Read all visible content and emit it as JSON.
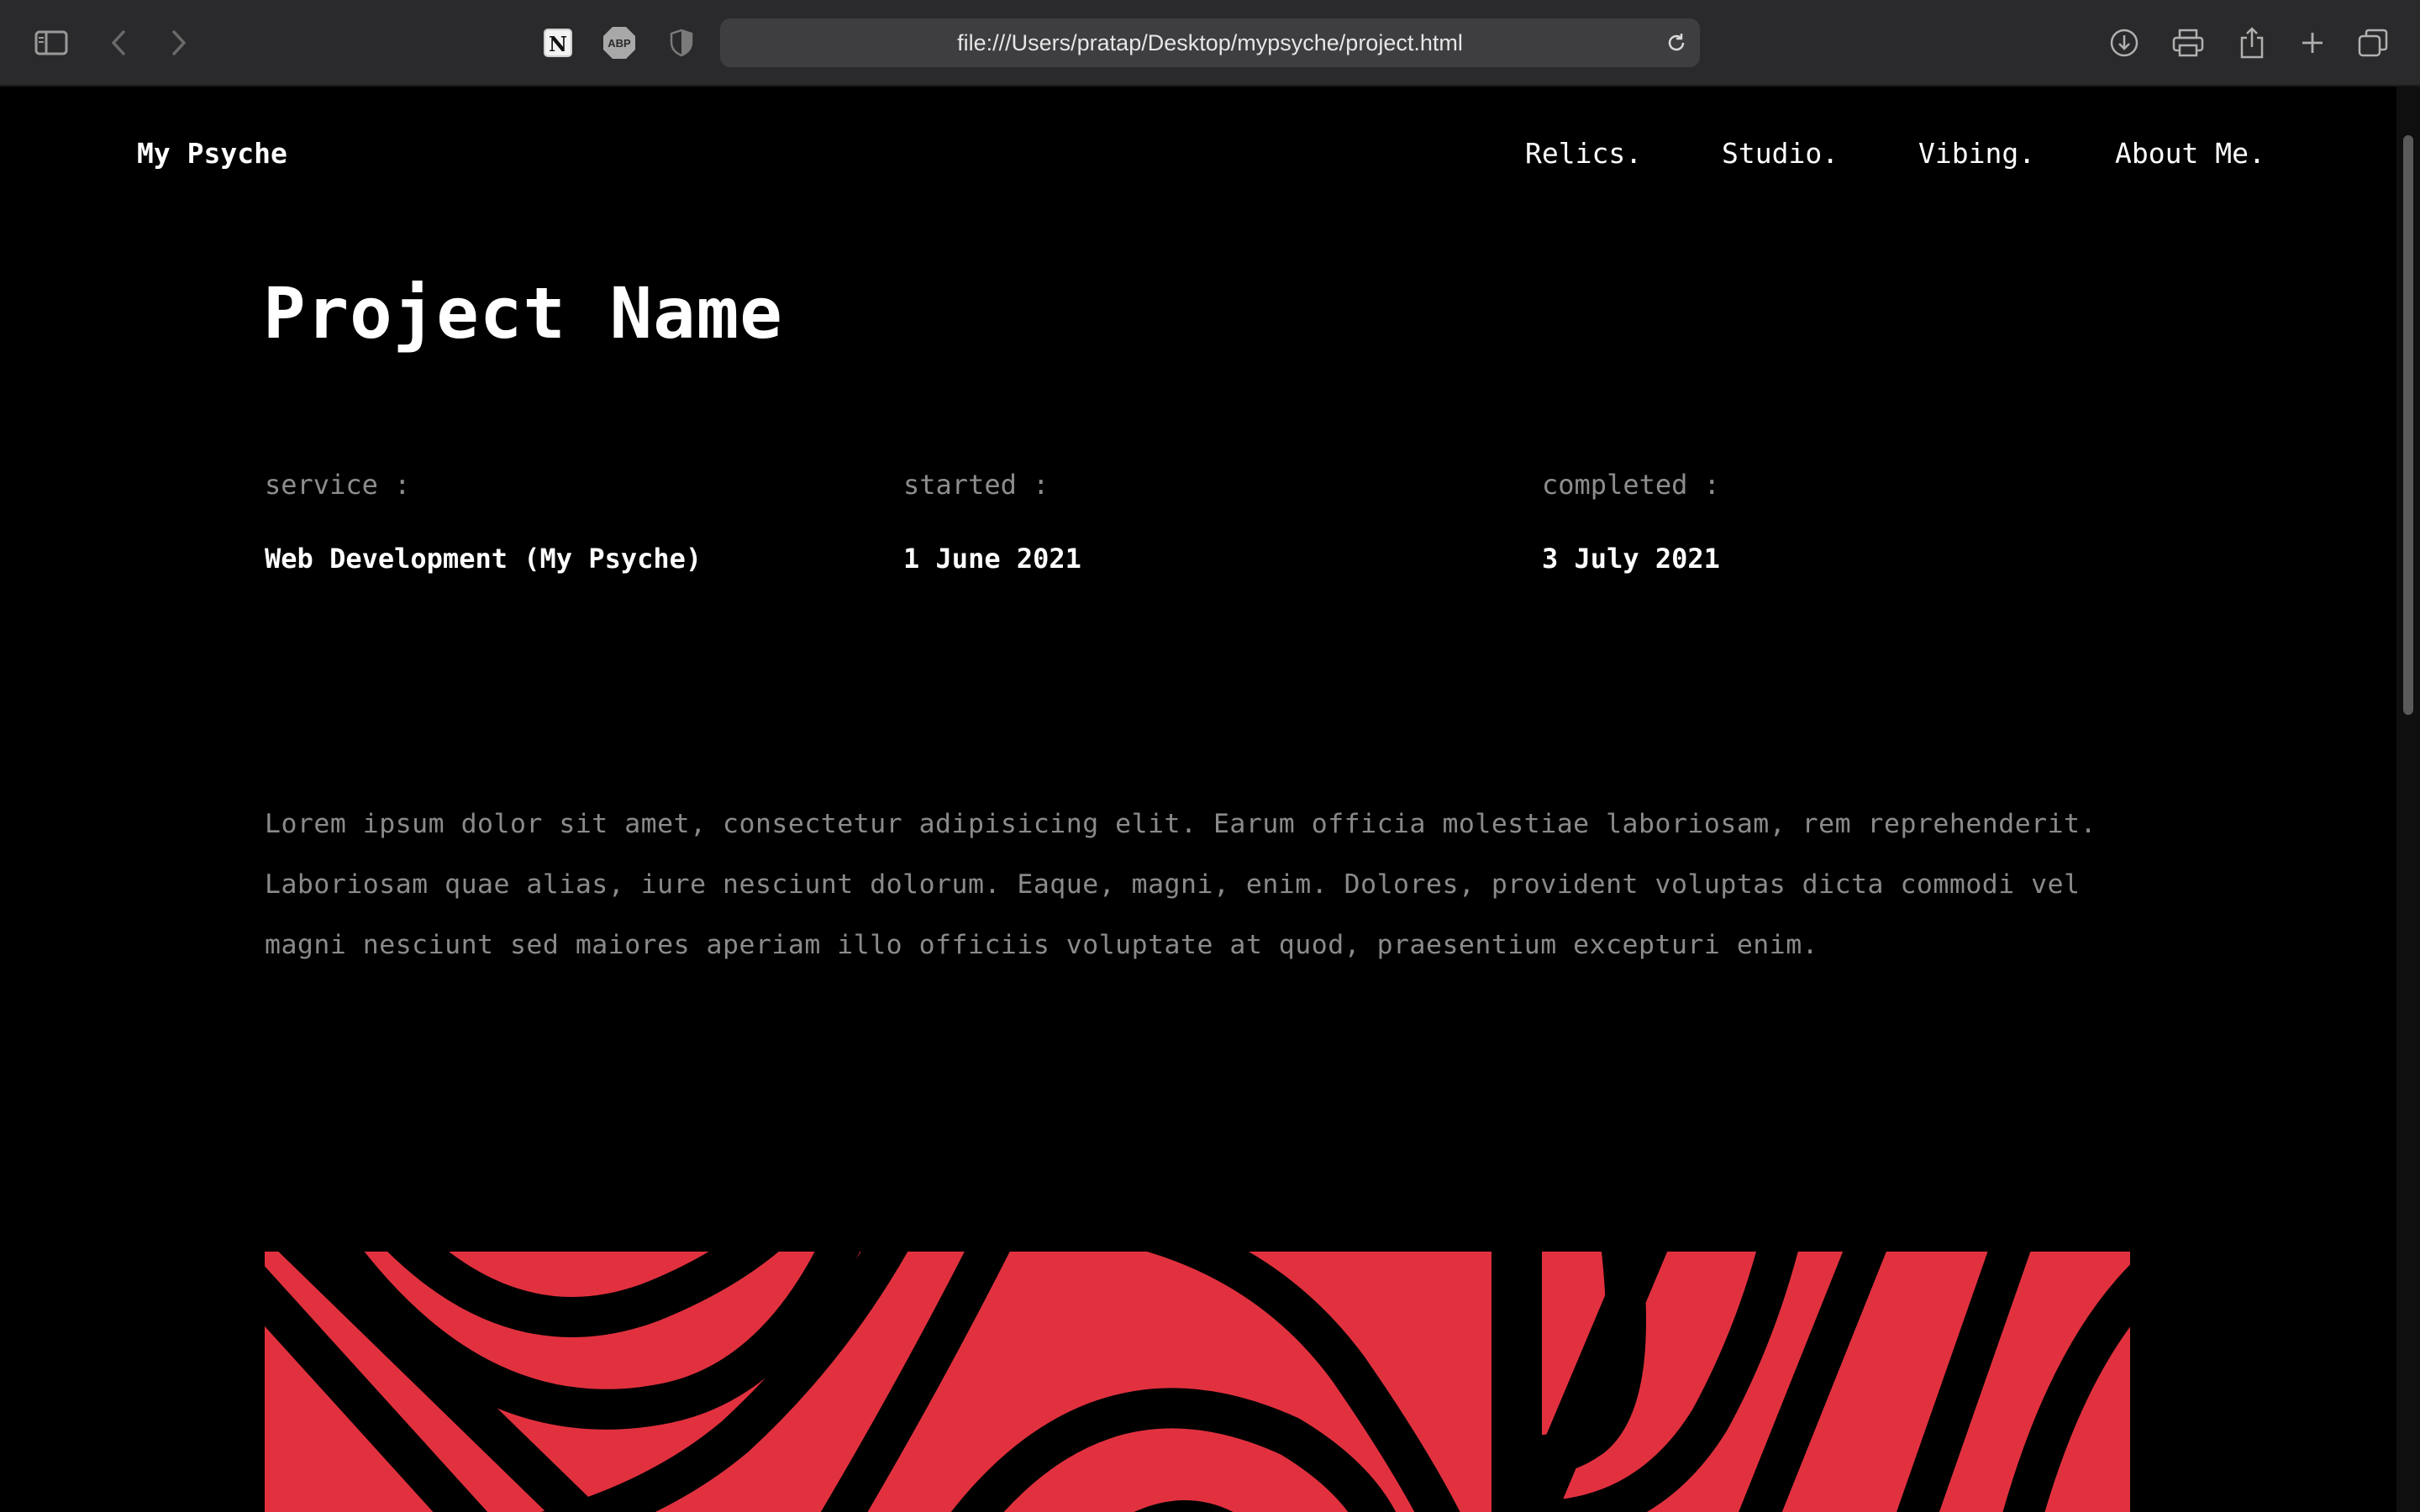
{
  "browser": {
    "url": "file:///Users/pratap/Desktop/mypsyche/project.html",
    "icons": [
      "sidebar-icon",
      "back-icon",
      "forward-icon",
      "notion-icon",
      "adblock-icon",
      "privacy-shield-icon",
      "reload-icon",
      "download-icon",
      "print-icon",
      "share-icon",
      "new-tab-icon",
      "tab-overview-icon"
    ],
    "adblock_label": "ABP"
  },
  "site": {
    "brand": "My Psyche",
    "nav": [
      "Relics.",
      "Studio.",
      "Vibing.",
      "About Me."
    ]
  },
  "project": {
    "title": "Project Name",
    "meta": [
      {
        "label": "service :",
        "value": "Web Development (My Psyche)"
      },
      {
        "label": "started :",
        "value": "1 June 2021"
      },
      {
        "label": "completed :",
        "value": "3 July 2021"
      }
    ],
    "description": "Lorem ipsum dolor sit amet, consectetur adipisicing elit. Earum officia molestiae laboriosam, rem reprehenderit. Laboriosam quae alias, iure nesciunt dolorum. Eaque, magni, enim. Dolores, provident voluptas dicta commodi vel magni nesciunt sed maiores aperiam illo officiis voluptate at quod, praesentium excepturi enim."
  },
  "colors": {
    "background": "#000000",
    "art_red": "#e1313f",
    "chrome": "#2a2a2c",
    "muted_text": "#8a8a8a"
  }
}
